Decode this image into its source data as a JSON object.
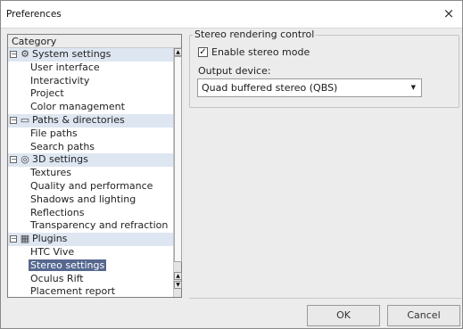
{
  "window": {
    "title": "Preferences",
    "close_label": "×"
  },
  "category": {
    "header": "Category",
    "groups": [
      {
        "label": "System settings",
        "icon": "gear-icon",
        "icon_glyph": "⚙",
        "children": [
          "User interface",
          "Interactivity",
          "Project",
          "Color management"
        ]
      },
      {
        "label": "Paths & directories",
        "icon": "folder-icon",
        "icon_glyph": "▭",
        "children": [
          "File paths",
          "Search paths"
        ]
      },
      {
        "label": "3D settings",
        "icon": "cube-icon",
        "icon_glyph": "◎",
        "children": [
          "Textures",
          "Quality and performance",
          "Shadows and lighting",
          "Reflections",
          "Transparency and refraction"
        ]
      },
      {
        "label": "Plugins",
        "icon": "plugin-icon",
        "icon_glyph": "▦",
        "children": [
          "HTC Vive",
          "Stereo settings",
          "Oculus Rift",
          "Placement report"
        ]
      }
    ],
    "selected": "Stereo settings"
  },
  "stereo": {
    "group_title": "Stereo rendering control",
    "enable_label": "Enable stereo mode",
    "enabled": true,
    "output_label": "Output device:",
    "output_value": "Quad buffered stereo (QBS)"
  },
  "buttons": {
    "ok": "OK",
    "cancel": "Cancel"
  },
  "colors": {
    "selection": "#56688f",
    "group_row": "#dde6f1"
  }
}
